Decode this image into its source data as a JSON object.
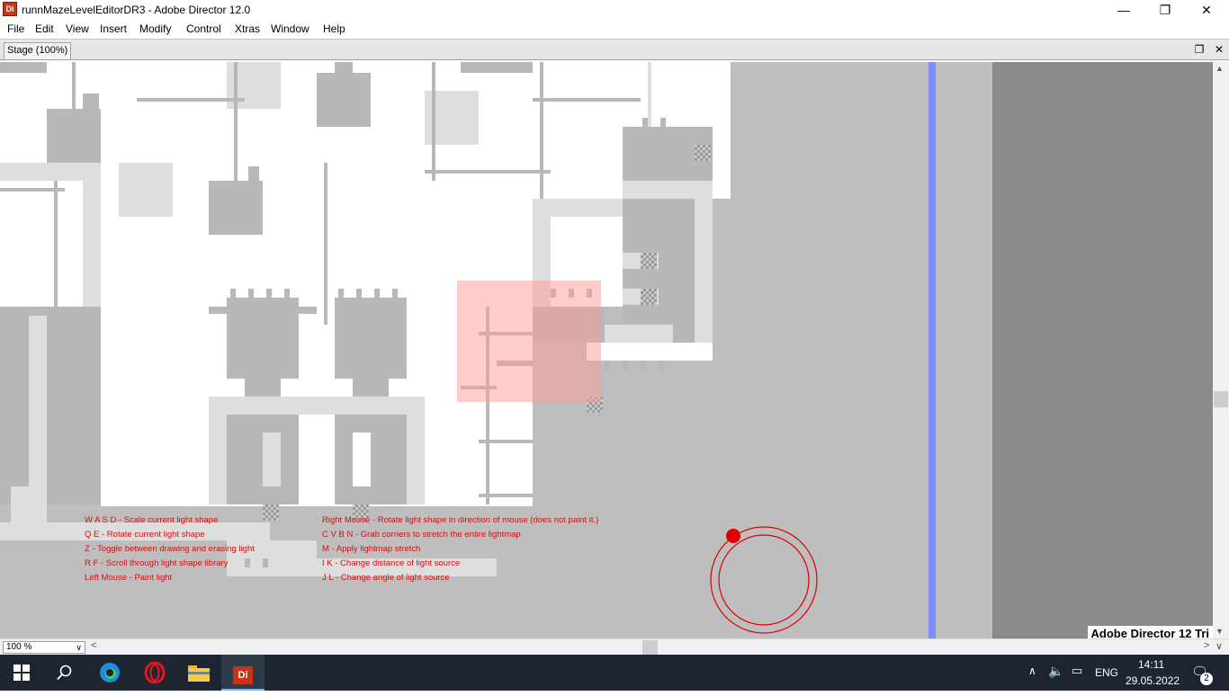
{
  "window": {
    "app_icon": "Di",
    "title": "runnMazeLevelEditorDR3 - Adobe Director 12.0",
    "minimize_icon": "minimize-icon",
    "maximize_icon": "restore-icon",
    "close_icon": "close-icon"
  },
  "menu": {
    "items": [
      "File",
      "Edit",
      "View",
      "Insert",
      "Modify",
      "Control",
      "Xtras",
      "Window",
      "Help"
    ]
  },
  "stage_panel": {
    "tab_label": "Stage (100%)",
    "restore_icon": "restore-panel-icon",
    "close_icon": "close-panel-icon",
    "zoom_value": "100 %",
    "trial_label": "Adobe Director 12 Tri"
  },
  "help": {
    "left": [
      "W A S D - Scale current light shape",
      "Q E - Rotate current light shape",
      "Z - Toggle between drawing and erasing light",
      "R F - Scroll through light shape library",
      "Left Mouse - Paint light"
    ],
    "right": [
      "Right Mouse - Rotate light shape in direction of mouse (does not paint it.)",
      "C V B N - Grab corners to stretch the entire lightmap",
      "M - Apply lightmap stretch",
      "I K - Change distance of light source",
      "J L - Change angle of light source"
    ]
  },
  "colors": {
    "help_text": "#d01010",
    "light_rect": "#ff9a9a",
    "blue_line": "#7d8cff",
    "light_source": "#e00000",
    "taskbar": "#1c2530"
  },
  "taskbar": {
    "apps": [
      "windows-start-icon",
      "search-icon",
      "edge-browser-icon",
      "opera-browser-icon",
      "file-explorer-icon",
      "adobe-director-icon"
    ],
    "director_label": "Di",
    "language": "ENG",
    "time": "14:11",
    "date": "29.05.2022",
    "notification_count": "2"
  }
}
